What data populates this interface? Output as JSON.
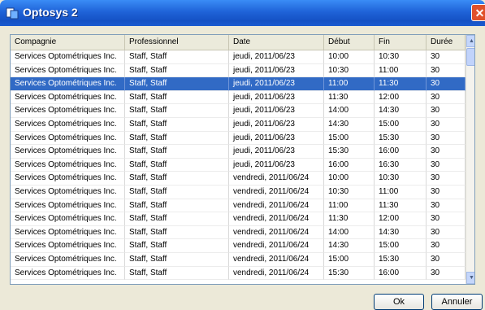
{
  "window": {
    "title": "Optosys 2"
  },
  "table": {
    "columns": [
      "Compagnie",
      "Professionnel",
      "Date",
      "Début",
      "Fin",
      "Durée"
    ],
    "selected_row": 2,
    "rows": [
      [
        "Services Optométriques Inc.",
        "Staff, Staff",
        "jeudi, 2011/06/23",
        "10:00",
        "10:30",
        "30"
      ],
      [
        "Services Optométriques Inc.",
        "Staff, Staff",
        "jeudi, 2011/06/23",
        "10:30",
        "11:00",
        "30"
      ],
      [
        "Services Optométriques Inc.",
        "Staff, Staff",
        "jeudi, 2011/06/23",
        "11:00",
        "11:30",
        "30"
      ],
      [
        "Services Optométriques Inc.",
        "Staff, Staff",
        "jeudi, 2011/06/23",
        "11:30",
        "12:00",
        "30"
      ],
      [
        "Services Optométriques Inc.",
        "Staff, Staff",
        "jeudi, 2011/06/23",
        "14:00",
        "14:30",
        "30"
      ],
      [
        "Services Optométriques Inc.",
        "Staff, Staff",
        "jeudi, 2011/06/23",
        "14:30",
        "15:00",
        "30"
      ],
      [
        "Services Optométriques Inc.",
        "Staff, Staff",
        "jeudi, 2011/06/23",
        "15:00",
        "15:30",
        "30"
      ],
      [
        "Services Optométriques Inc.",
        "Staff, Staff",
        "jeudi, 2011/06/23",
        "15:30",
        "16:00",
        "30"
      ],
      [
        "Services Optométriques Inc.",
        "Staff, Staff",
        "jeudi, 2011/06/23",
        "16:00",
        "16:30",
        "30"
      ],
      [
        "Services Optométriques Inc.",
        "Staff, Staff",
        "vendredi, 2011/06/24",
        "10:00",
        "10:30",
        "30"
      ],
      [
        "Services Optométriques Inc.",
        "Staff, Staff",
        "vendredi, 2011/06/24",
        "10:30",
        "11:00",
        "30"
      ],
      [
        "Services Optométriques Inc.",
        "Staff, Staff",
        "vendredi, 2011/06/24",
        "11:00",
        "11:30",
        "30"
      ],
      [
        "Services Optométriques Inc.",
        "Staff, Staff",
        "vendredi, 2011/06/24",
        "11:30",
        "12:00",
        "30"
      ],
      [
        "Services Optométriques Inc.",
        "Staff, Staff",
        "vendredi, 2011/06/24",
        "14:00",
        "14:30",
        "30"
      ],
      [
        "Services Optométriques Inc.",
        "Staff, Staff",
        "vendredi, 2011/06/24",
        "14:30",
        "15:00",
        "30"
      ],
      [
        "Services Optométriques Inc.",
        "Staff, Staff",
        "vendredi, 2011/06/24",
        "15:00",
        "15:30",
        "30"
      ],
      [
        "Services Optométriques Inc.",
        "Staff, Staff",
        "vendredi, 2011/06/24",
        "15:30",
        "16:00",
        "30"
      ]
    ]
  },
  "buttons": {
    "ok": "Ok",
    "cancel": "Annuler"
  },
  "icons": {
    "app": "app-icon",
    "close": "close-icon",
    "scroll_up": "scroll-up-icon",
    "scroll_down": "scroll-down-icon"
  },
  "colors": {
    "titlebar": "#1f63d8",
    "selection": "#316ac5",
    "window_bg": "#ece9d8",
    "close": "#e0512b"
  }
}
